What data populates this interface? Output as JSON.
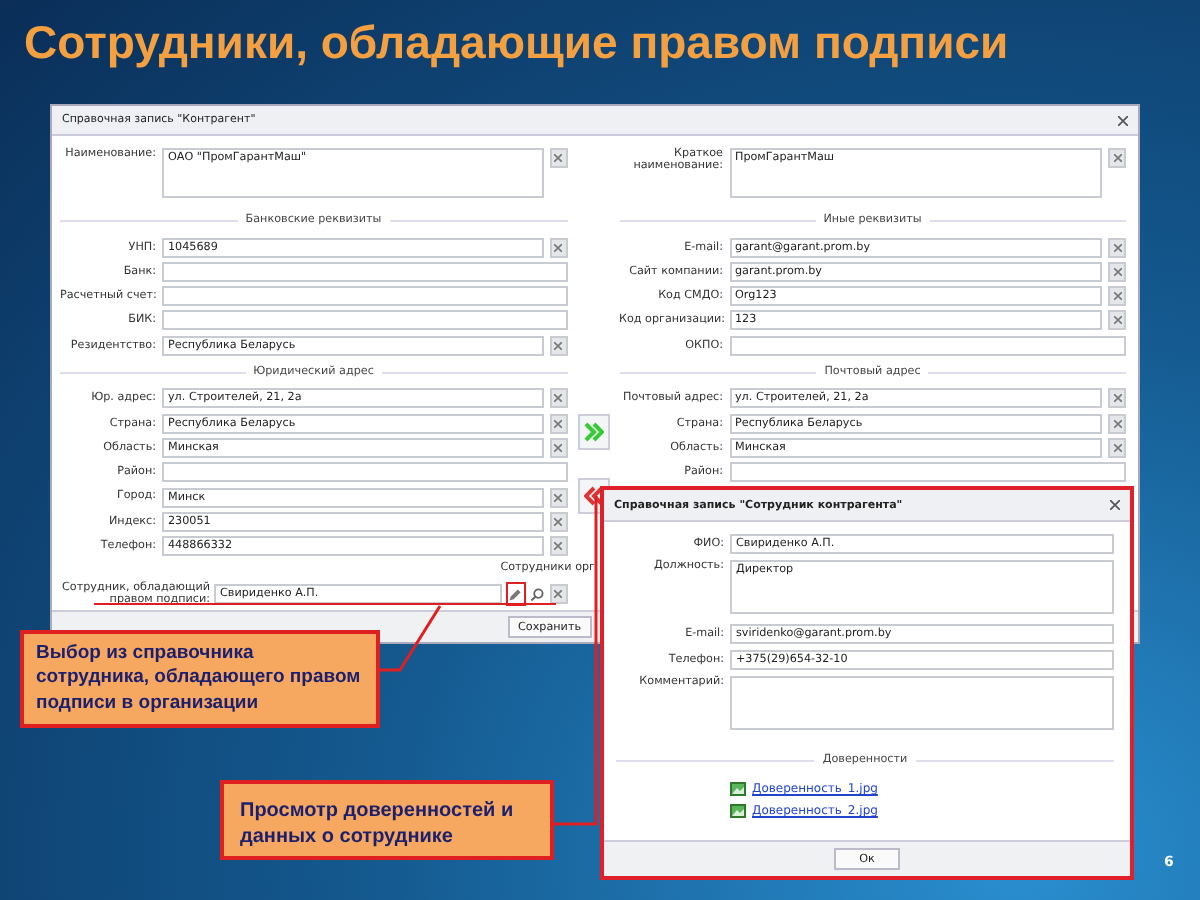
{
  "slide_title": "Сотрудники, обладающие правом подписи",
  "main_window": {
    "title": "Справочная запись \"Контрагент\"",
    "columns": [
      {
        "rows": [
          {
            "kind": "textarea",
            "label": "Наименование:",
            "value": "ОАО \"ПромГарантМаш\"",
            "clearable": true
          },
          {
            "kind": "heading",
            "label": "Банковские реквизиты"
          },
          {
            "kind": "field",
            "label": "УНП:",
            "value": "1045689",
            "clearable": true
          },
          {
            "kind": "field",
            "label": "Банк:",
            "clearable": false
          },
          {
            "kind": "field",
            "label": "Расчетный счет:",
            "clearable": false
          },
          {
            "kind": "field",
            "label": "БИК:",
            "clearable": false
          },
          {
            "kind": "field",
            "label": "Резидентство:",
            "value": "Республика Беларусь",
            "clearable": true
          },
          {
            "kind": "heading",
            "label": "Юридический адрес"
          },
          {
            "kind": "field",
            "label": "Юр. адрес:",
            "value": "ул. Строителей, 21, 2а",
            "clearable": true
          },
          {
            "kind": "field",
            "label": "Страна:",
            "value": "Республика Беларусь",
            "clearable": true
          },
          {
            "kind": "field",
            "label": "Область:",
            "value": "Минская",
            "clearable": true
          },
          {
            "kind": "field",
            "label": "Район:",
            "clearable": false
          },
          {
            "kind": "field",
            "label": "Город:",
            "value": "Минск",
            "clearable": true
          },
          {
            "kind": "field",
            "label": "Индекс:",
            "value": "230051",
            "clearable": true
          },
          {
            "kind": "field",
            "label": "Телефон:",
            "value": "448866332",
            "clearable": true
          }
        ]
      },
      {
        "rows": [
          {
            "kind": "textarea",
            "label": "Краткое наименование:",
            "value": "ПромГарантМаш",
            "clearable": true
          },
          {
            "kind": "heading",
            "label": "Иные реквизиты"
          },
          {
            "kind": "field",
            "label": "E-mail:",
            "value": "garant@garant.prom.by",
            "clearable": true
          },
          {
            "kind": "field",
            "label": "Сайт компании:",
            "value": "garant.prom.by",
            "clearable": true
          },
          {
            "kind": "field",
            "label": "Код СМДО:",
            "value": "Org123",
            "clearable": true
          },
          {
            "kind": "field",
            "label": "Код организации:",
            "value": "123",
            "clearable": true
          },
          {
            "kind": "field",
            "label": "ОКПО:",
            "clearable": false
          },
          {
            "kind": "heading",
            "label": "Почтовый адрес"
          },
          {
            "kind": "field",
            "label": "Почтовый адрес:",
            "value": "ул. Строителей, 21, 2а",
            "clearable": true
          },
          {
            "kind": "field",
            "label": "Страна:",
            "value": "Республика Беларусь",
            "clearable": true
          },
          {
            "kind": "field",
            "label": "Область:",
            "value": "Минская",
            "clearable": true
          },
          {
            "kind": "field",
            "label": "Район:",
            "clearable": false
          }
        ]
      }
    ],
    "signatory": {
      "label": "Сотрудник, обладающий правом подписи:",
      "value": "Свириденко А.П.",
      "side_label": "Сотрудники орг"
    },
    "save_button": "Сохранить"
  },
  "popup": {
    "title": "Справочная запись \"Сотрудник контрагента\"",
    "fields": [
      {
        "kind": "field",
        "label": "ФИО:",
        "value": "Свириденко А.П."
      },
      {
        "kind": "textarea",
        "label": "Должность:",
        "value": "Директор"
      },
      {
        "kind": "field",
        "label": "E-mail:",
        "value": "sviridenko@garant.prom.by"
      },
      {
        "kind": "field",
        "label": "Телефон:",
        "value": "+375(29)654-32-10"
      },
      {
        "kind": "textarea",
        "label": "Комментарий:"
      }
    ],
    "section": "Доверенности",
    "attachments": [
      "Доверенность_1.jpg",
      "Доверенность_2.jpg"
    ],
    "ok_button": "Ок"
  },
  "callouts": [
    "Выбор из справочника сотрудника, обладающего правом подписи в организации",
    "Просмотр доверенностей и данных о сотруднике"
  ],
  "page_number": "6"
}
